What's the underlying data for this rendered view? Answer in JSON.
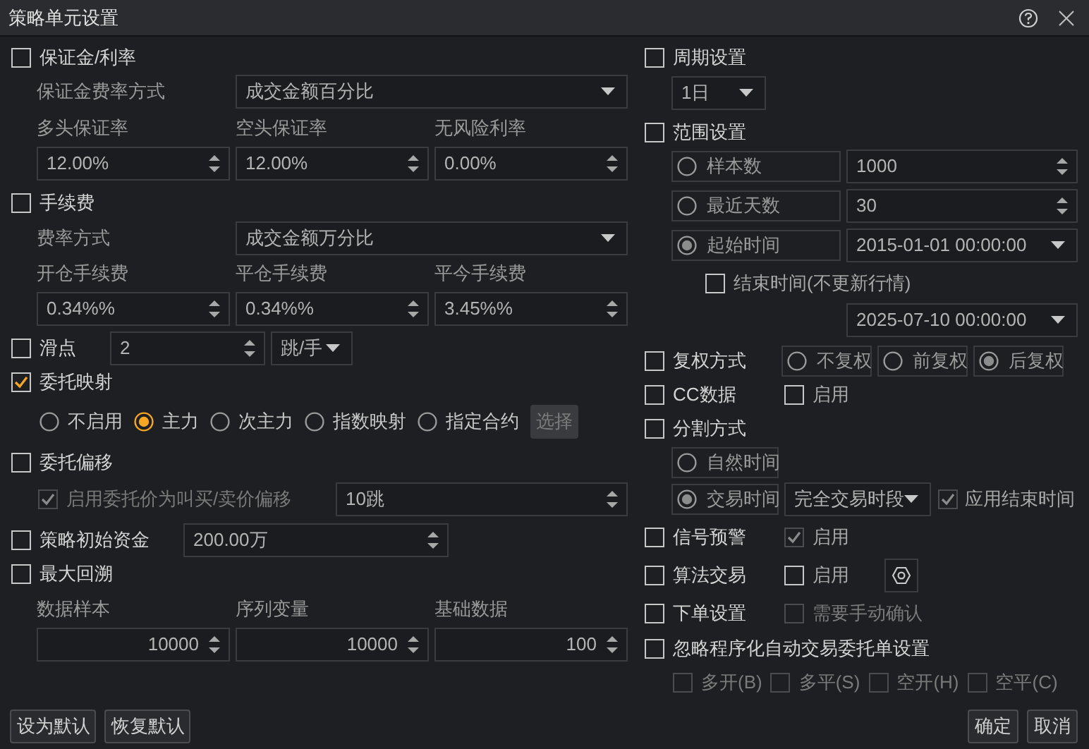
{
  "window": {
    "title": "策略单元设置"
  },
  "margin": {
    "label": "保证金/利率",
    "checked": false,
    "mode_label": "保证金费率方式",
    "mode": "成交金额百分比",
    "fields": [
      {
        "label": "多头保证率",
        "value": "12.00%"
      },
      {
        "label": "空头保证率",
        "value": "12.00%"
      },
      {
        "label": "无风险利率",
        "value": "0.00%"
      }
    ]
  },
  "commission": {
    "label": "手续费",
    "checked": false,
    "mode_label": "费率方式",
    "mode": "成交金额万分比",
    "fields": [
      {
        "label": "开仓手续费",
        "value": "0.34%%"
      },
      {
        "label": "平仓手续费",
        "value": "0.34%%"
      },
      {
        "label": "平今手续费",
        "value": "3.45%%"
      }
    ]
  },
  "slippage": {
    "label": "滑点",
    "checked": false,
    "value": "2",
    "unit": "跳/手"
  },
  "order_mapping": {
    "label": "委托映射",
    "checked": true,
    "options": [
      {
        "label": "不启用",
        "selected": false
      },
      {
        "label": "主力",
        "selected": true
      },
      {
        "label": "次主力",
        "selected": false
      },
      {
        "label": "指数映射",
        "selected": false
      },
      {
        "label": "指定合约",
        "selected": false
      }
    ],
    "choose_button": "选择"
  },
  "order_offset": {
    "label": "委托偏移",
    "checked": false,
    "option": {
      "label": "启用委托价为叫买/卖价偏移",
      "checked": true,
      "disabled": true
    },
    "value": "10跳"
  },
  "initial_capital": {
    "label": "策略初始资金",
    "checked": false,
    "value": "200.00万"
  },
  "max_lookback": {
    "label": "最大回溯",
    "checked": false,
    "fields": [
      {
        "label": "数据样本",
        "value": "10000"
      },
      {
        "label": "序列变量",
        "value": "10000"
      },
      {
        "label": "基础数据",
        "value": "100"
      }
    ]
  },
  "period": {
    "label": "周期设置",
    "checked": false,
    "value": "1日"
  },
  "range": {
    "label": "范围设置",
    "checked": false,
    "options": [
      {
        "label": "样本数",
        "selected": false,
        "kind": "spin",
        "value": "1000"
      },
      {
        "label": "最近天数",
        "selected": false,
        "kind": "spin",
        "value": "30"
      },
      {
        "label": "起始时间",
        "selected": true,
        "kind": "dropdown",
        "value": "2015-01-01 00:00:00"
      }
    ],
    "end_time": {
      "label": "结束时间(不更新行情)",
      "checked": false
    },
    "end_value": "2025-07-10 00:00:00"
  },
  "adjustment": {
    "label": "复权方式",
    "checked": false,
    "options": [
      {
        "label": "不复权",
        "selected": false
      },
      {
        "label": "前复权",
        "selected": false
      },
      {
        "label": "后复权",
        "selected": true
      }
    ]
  },
  "cc_data": {
    "label": "CC数据",
    "checked": false,
    "enable": {
      "label": "启用",
      "checked": false,
      "disabled": false
    }
  },
  "split": {
    "label": "分割方式",
    "checked": false,
    "options": [
      {
        "label": "自然时间",
        "selected": false
      },
      {
        "label": "交易时间",
        "selected": true
      }
    ],
    "session": "完全交易时段",
    "apply_end": {
      "label": "应用结束时间",
      "checked": true
    }
  },
  "signal_alert": {
    "label": "信号预警",
    "checked": false,
    "enable": {
      "label": "启用",
      "checked": true
    }
  },
  "algo_trading": {
    "label": "算法交易",
    "checked": false,
    "enable": {
      "label": "启用",
      "checked": false,
      "disabled": false
    }
  },
  "order_settings": {
    "label": "下单设置",
    "checked": false,
    "enable": {
      "label": "需要手动确认",
      "checked": false,
      "disabled": true
    }
  },
  "ignore_auto": {
    "label": "忽略程序化自动交易委托单设置",
    "checked": false,
    "options": [
      {
        "label": "多开(B)",
        "checked": false,
        "disabled": true
      },
      {
        "label": "多平(S)",
        "checked": false,
        "disabled": true
      },
      {
        "label": "空开(H)",
        "checked": false,
        "disabled": true
      },
      {
        "label": "空平(C)",
        "checked": false,
        "disabled": true
      }
    ]
  },
  "buttons_left": [
    "设为默认",
    "恢复默认"
  ],
  "buttons_right": [
    "确定",
    "取消"
  ]
}
